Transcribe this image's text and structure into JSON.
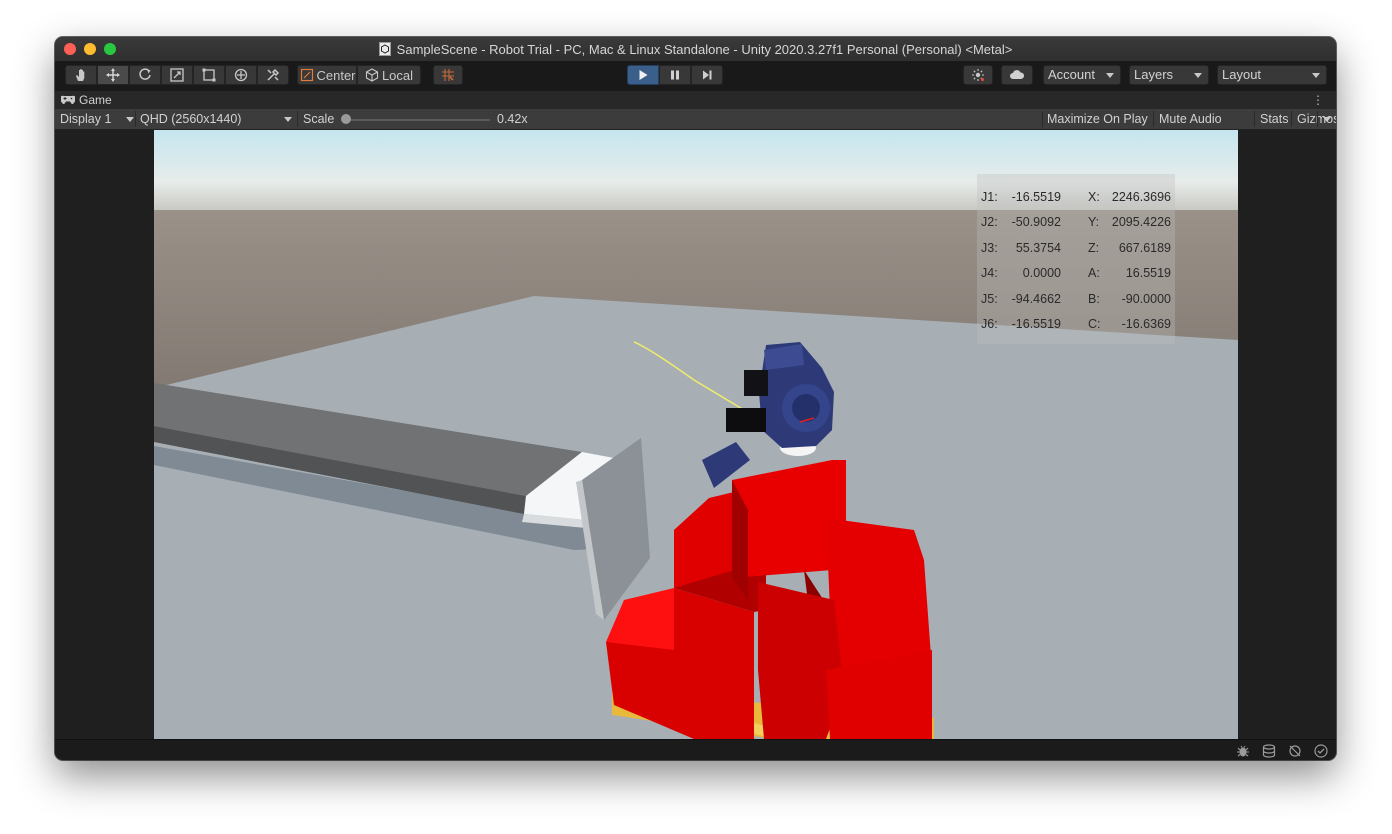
{
  "window": {
    "title": "SampleScene - Robot Trial - PC, Mac & Linux Standalone - Unity 2020.3.27f1 Personal (Personal) <Metal>"
  },
  "toolbar": {
    "tools": [
      "hand-icon",
      "move-icon",
      "rotate-icon",
      "scale-icon",
      "rect-icon",
      "transform-icon",
      "custom-tool-icon"
    ],
    "pivot_mode": "Center",
    "pivot_rotation": "Local",
    "account_label": "Account",
    "layers_label": "Layers",
    "layout_label": "Layout",
    "play_state": "playing"
  },
  "game_tab": {
    "label": "Game"
  },
  "game_bar": {
    "display": "Display 1",
    "resolution": "QHD (2560x1440)",
    "scale_label": "Scale",
    "scale_value": "0.42x",
    "scale_fraction": 0.0,
    "maximize_label": "Maximize On Play",
    "mute_label": "Mute Audio",
    "stats_label": "Stats",
    "gizmos_label": "Gizmos"
  },
  "readout": {
    "rows": [
      {
        "jl": "J1:",
        "jv": "-16.5519",
        "cl": "X:",
        "cv": "2246.3696"
      },
      {
        "jl": "J2:",
        "jv": "-50.9092",
        "cl": "Y:",
        "cv": "2095.4226"
      },
      {
        "jl": "J3:",
        "jv": "55.3754",
        "cl": "Z:",
        "cv": "667.6189"
      },
      {
        "jl": "J4:",
        "jv": "0.0000",
        "cl": "A:",
        "cv": "16.5519"
      },
      {
        "jl": "J5:",
        "jv": "-94.4662",
        "cl": "B:",
        "cv": "-90.0000"
      },
      {
        "jl": "J6:",
        "jv": "-16.5519",
        "cl": "C:",
        "cv": "-16.6369"
      }
    ]
  },
  "colors": {
    "play_accent": "#3a5f8a",
    "boxes": "#e00000",
    "robot": "#2e3a78",
    "pallet": "#e8b93a"
  }
}
